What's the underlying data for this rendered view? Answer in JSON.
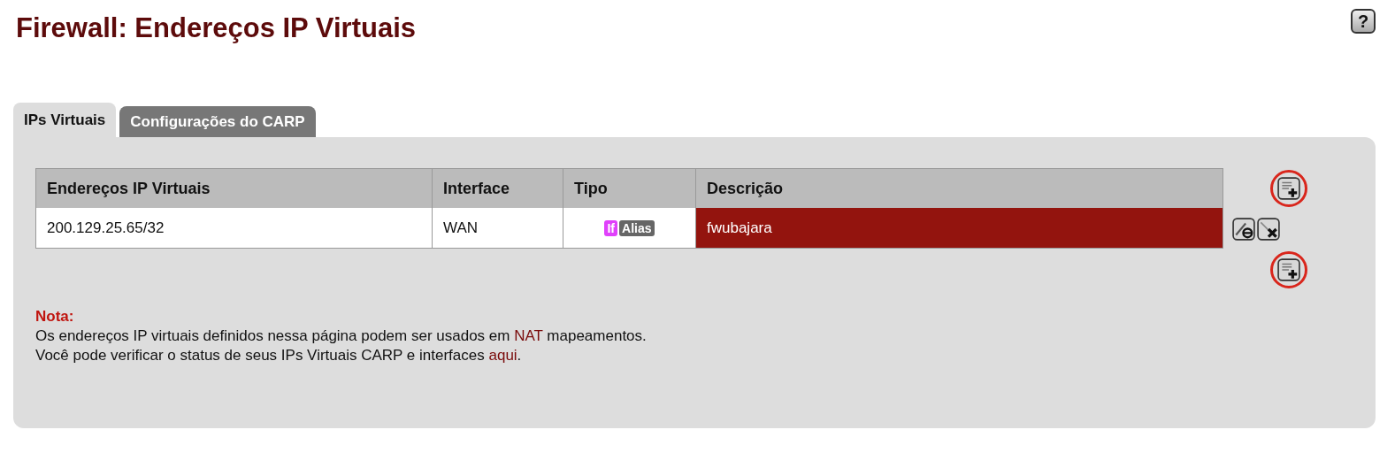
{
  "page": {
    "title": "Firewall: Endereços IP Virtuais",
    "help_button": "?"
  },
  "tabs": [
    {
      "label": "IPs Virtuais",
      "selected": true
    },
    {
      "label": "Configurações do CARP",
      "selected": false
    }
  ],
  "table": {
    "columns": [
      "Endereços IP Virtuais",
      "Interface",
      "Tipo",
      "Descrição"
    ],
    "rows": [
      {
        "address": "200.129.25.65/32",
        "interface": "WAN",
        "type_badges": [
          {
            "label": "If",
            "color": "#e040fb"
          },
          {
            "label": "Alias",
            "color": "#666666"
          }
        ],
        "description": "fwubajara",
        "highlighted": true
      }
    ],
    "top_add_highlighted": true,
    "bottom_add_highlighted": true
  },
  "note": {
    "heading": "Nota:",
    "lines": [
      [
        {
          "text": "Os endereços IP virtuais definidos nessa página podem ser usados em ",
          "kind": "plain"
        },
        {
          "text": "NAT",
          "kind": "link"
        },
        {
          "text": " mapeamentos.",
          "kind": "plain"
        }
      ],
      [
        {
          "text": "Você pode verificar o status de seus IPs Virtuais CARP e interfaces ",
          "kind": "plain"
        },
        {
          "text": "aqui",
          "kind": "link"
        },
        {
          "text": ".",
          "kind": "plain"
        }
      ]
    ]
  }
}
